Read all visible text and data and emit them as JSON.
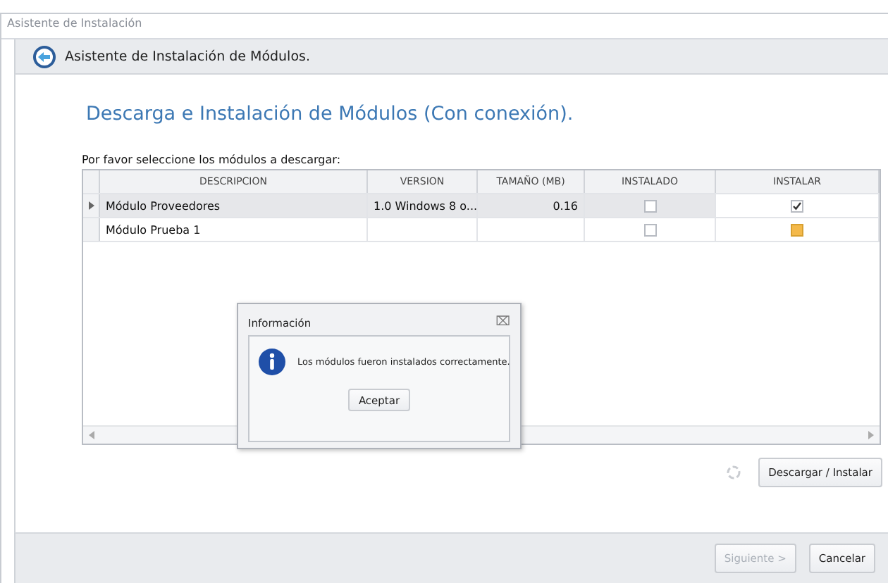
{
  "window": {
    "title": "Asistente de Instalación"
  },
  "header": {
    "title": "Asistente de Instalación de Módulos."
  },
  "page": {
    "heading": "Descarga e Instalación de Módulos (Con conexión).",
    "prompt": "Por favor seleccione los módulos a descargar:"
  },
  "table": {
    "columns": [
      "DESCRIPCION",
      "VERSION",
      "TAMAÑO (MB)",
      "INSTALADO",
      "INSTALAR"
    ],
    "rows": [
      {
        "selected": true,
        "description": "Módulo Proveedores",
        "version": "1.0 Windows 8 o...",
        "size": "0.16",
        "installed": false,
        "install": true,
        "hot": false
      },
      {
        "selected": false,
        "description": "Módulo Prueba 1",
        "installed": false,
        "install": false,
        "hot": true
      }
    ]
  },
  "dialog": {
    "title": "Información",
    "close": "⌧",
    "message": "Los módulos fueron instalados correctamente.",
    "button": "Aceptar"
  },
  "download_button": {
    "label": "Descargar / Instalar"
  },
  "footer": {
    "buttons": [
      {
        "label": "Siguiente >",
        "disabled": true
      },
      {
        "label": "Cancelar",
        "disabled": false
      }
    ]
  }
}
